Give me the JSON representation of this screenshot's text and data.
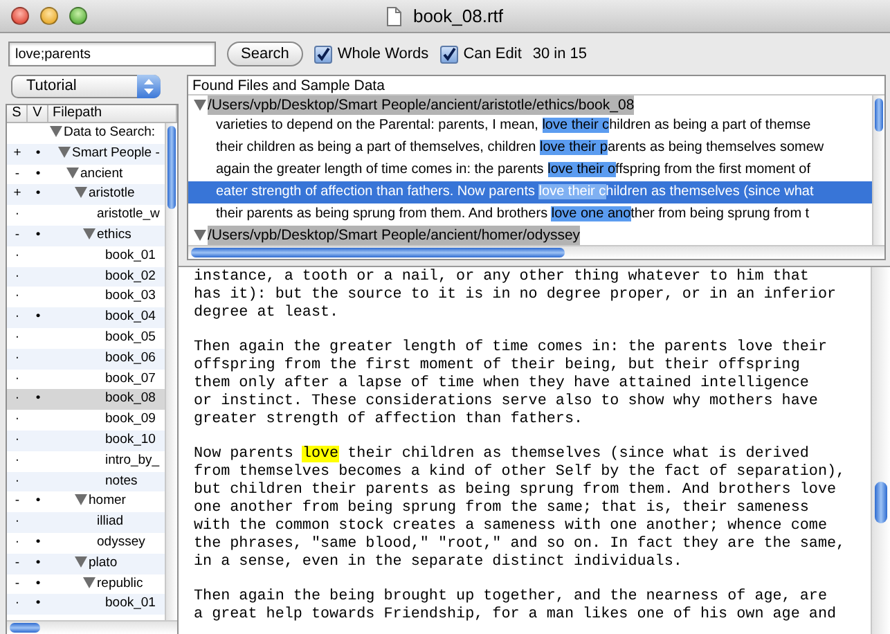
{
  "window": {
    "title": "book_08.rtf"
  },
  "toolbar": {
    "search": {
      "value": "love;parents"
    },
    "search_button": "Search",
    "options": [
      {
        "label": "Whole Words",
        "checked": true
      },
      {
        "label": "Can Edit",
        "checked": true
      }
    ],
    "count": "30 in 15"
  },
  "sidebar": {
    "dropdown": "Tutorial",
    "columns": [
      "S",
      "V",
      "Filepath"
    ],
    "tree": [
      {
        "name": "Data to Search:",
        "expanded": true,
        "selected": false,
        "children": [
          {
            "s": "+",
            "v": "•",
            "name": "Smart People -",
            "expanded": true,
            "selected": false,
            "children": [
              {
                "s": "-",
                "v": "•",
                "name": "ancient",
                "expanded": true,
                "selected": false,
                "children": [
                  {
                    "s": "+",
                    "v": "•",
                    "name": "aristotle",
                    "expanded": true,
                    "selected": false,
                    "children": [
                      {
                        "s": "·",
                        "name": "aristotle_w",
                        "selected": false
                      },
                      {
                        "s": "-",
                        "v": "•",
                        "name": "ethics",
                        "expanded": true,
                        "selected": false,
                        "children": [
                          {
                            "s": "·",
                            "name": "book_01",
                            "selected": false
                          },
                          {
                            "s": "·",
                            "name": "book_02",
                            "selected": false
                          },
                          {
                            "s": "·",
                            "name": "book_03",
                            "selected": false
                          },
                          {
                            "s": "·",
                            "v": "•",
                            "name": "book_04",
                            "selected": false
                          },
                          {
                            "s": "·",
                            "name": "book_05",
                            "selected": false
                          },
                          {
                            "s": "·",
                            "name": "book_06",
                            "selected": false
                          },
                          {
                            "s": "·",
                            "name": "book_07",
                            "selected": false
                          },
                          {
                            "s": "·",
                            "v": "•",
                            "name": "book_08",
                            "selected": true
                          },
                          {
                            "s": "·",
                            "name": "book_09",
                            "selected": false
                          },
                          {
                            "s": "·",
                            "name": "book_10",
                            "selected": false
                          },
                          {
                            "s": "·",
                            "name": "intro_by_",
                            "selected": false
                          },
                          {
                            "s": "·",
                            "name": "notes",
                            "selected": false
                          }
                        ]
                      }
                    ]
                  },
                  {
                    "s": "-",
                    "v": "•",
                    "name": "homer",
                    "expanded": true,
                    "selected": false,
                    "children": [
                      {
                        "s": "·",
                        "name": "illiad",
                        "selected": false
                      },
                      {
                        "s": "·",
                        "v": "•",
                        "name": "odyssey",
                        "selected": false
                      }
                    ]
                  },
                  {
                    "s": "-",
                    "v": "•",
                    "name": "plato",
                    "expanded": true,
                    "selected": false,
                    "children": [
                      {
                        "s": "-",
                        "v": "•",
                        "name": "republic",
                        "expanded": true,
                        "selected": false,
                        "children": [
                          {
                            "s": "·",
                            "v": "•",
                            "name": "book_01",
                            "selected": false
                          }
                        ]
                      }
                    ]
                  }
                ]
              }
            ]
          }
        ]
      }
    ]
  },
  "results": {
    "title": "Found Files and Sample Data",
    "groups": [
      {
        "path": "/Users/vpb/Desktop/Smart People/ancient/aristotle/ethics/book_08",
        "expanded": true,
        "snippets": [
          {
            "before": " varieties to depend on the Parental: parents, I mean, ",
            "match": "love their c",
            "after": "hildren as being a part of themse",
            "selected": false
          },
          {
            "before": "their children as being a part of themselves, children ",
            "match": "love their p",
            "after": "arents as being themselves somew",
            "selected": false
          },
          {
            "before": "again the greater length of time comes in: the parents ",
            "match": "love their o",
            "after": "ffspring from the first moment of",
            "selected": false
          },
          {
            "before": "eater strength of affection than fathers.  Now parents ",
            "match": "love their c",
            "after": "hildren as themselves (since what",
            "selected": true
          },
          {
            "before": " their parents as being sprung from them. And brothers ",
            "match": "love one ano",
            "after": "ther from being sprung from t",
            "selected": false
          }
        ]
      },
      {
        "path": "/Users/vpb/Desktop/Smart People/ancient/homer/odyssey",
        "expanded": true
      }
    ]
  },
  "document": {
    "paragraphs": [
      [
        "instance, a tooth or a nail, or any other thing whatever to him that",
        "has it): but the source to it is in no degree proper, or in an inferior",
        "degree at least."
      ],
      [
        "Then again the greater length of time comes in: the parents love their",
        "offspring from the first moment of their being, but their offspring",
        "them only after a lapse of time when they have attained intelligence",
        "or instinct. These considerations serve also to show why mothers have",
        "greater strength of affection than fathers."
      ],
      [
        {
          "before": "Now parents ",
          "match": "love",
          "after": " their children as themselves (since what is derived"
        },
        "from themselves becomes a kind of other Self by the fact of separation),",
        "but children their parents as being sprung from them. And brothers love",
        "one another from being sprung from the same; that is, their sameness",
        "with the common stock creates a sameness with one another; whence come",
        "the phrases, \"same blood,\" \"root,\" and so on. In fact they are the same,",
        "in a sense, even in the separate distinct individuals."
      ],
      [
        "Then again the being brought up together, and the nearness of age, are",
        "a great help towards Friendship, for a man likes one of his own age and"
      ]
    ]
  }
}
